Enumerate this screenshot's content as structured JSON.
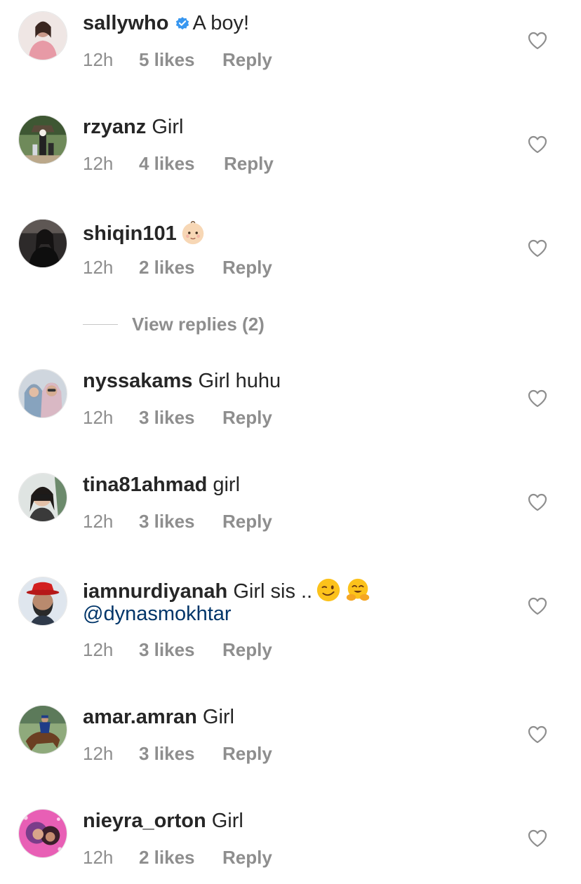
{
  "comments": [
    {
      "username": "sallywho",
      "verified": true,
      "text": "A boy!",
      "time": "12h",
      "likes": "5 likes",
      "reply": "Reply"
    },
    {
      "username": "rzyanz",
      "text": "Girl",
      "time": "12h",
      "likes": "4 likes",
      "reply": "Reply"
    },
    {
      "username": "shiqin101",
      "text": "",
      "emoji": "baby-emoji",
      "time": "12h",
      "likes": "2 likes",
      "reply": "Reply"
    },
    {
      "username": "nyssakams",
      "text": "Girl huhu",
      "time": "12h",
      "likes": "3 likes",
      "reply": "Reply"
    },
    {
      "username": "tina81ahmad",
      "text": "girl",
      "time": "12h",
      "likes": "3 likes",
      "reply": "Reply"
    },
    {
      "username": "iamnurdiyanah",
      "text": "Girl sis ..",
      "emojis": [
        "winking-face-emoji",
        "hugging-face-emoji"
      ],
      "mention": "@dynasmokhtar",
      "time": "12h",
      "likes": "3 likes",
      "reply": "Reply"
    },
    {
      "username": "amar.amran",
      "text": "Girl",
      "time": "12h",
      "likes": "3 likes",
      "reply": "Reply"
    },
    {
      "username": "nieyra_orton",
      "text": "Girl",
      "time": "12h",
      "likes": "2 likes",
      "reply": "Reply"
    }
  ],
  "view_replies": {
    "label": "View replies (2)"
  },
  "colors": {
    "text": "#262626",
    "meta": "#8e8e8e",
    "mention": "#003569",
    "verified": "#3897f0",
    "divider": "#c7c7c7"
  },
  "icons": {
    "like": "heart-outline-icon",
    "verified": "verified-badge-icon"
  }
}
